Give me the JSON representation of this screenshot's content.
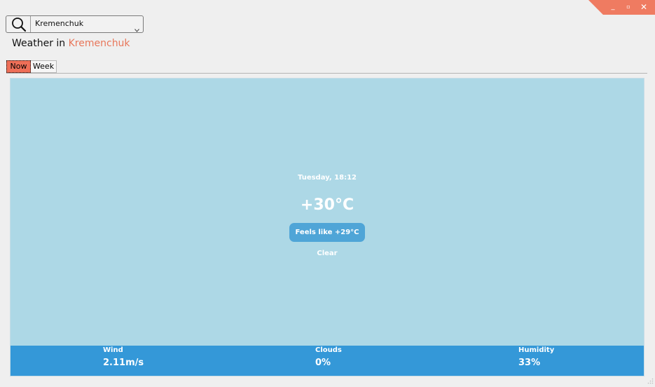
{
  "window": {
    "minimize_glyph": "_",
    "maximize_glyph": "▫",
    "close_glyph": "✕",
    "accent_color": "#ef7b61"
  },
  "search": {
    "icon": "search-icon",
    "selected_city": "Kremenchuk",
    "dropdown_icon": "chevron-down-icon"
  },
  "header": {
    "title_prefix": "Weather in",
    "city": "Kremenchuk",
    "city_color": "#e8775b"
  },
  "tabs": [
    {
      "label": "Now",
      "active": true
    },
    {
      "label": "Week",
      "active": false
    }
  ],
  "current": {
    "datetime": "Tuesday, 18:12",
    "temperature": "+30°C",
    "feels_like": "Feels like +29°C",
    "condition": "Clear",
    "panel_color": "#add8e6",
    "badge_color": "#4fa5d7"
  },
  "stats": {
    "bar_color": "#3498d8",
    "wind": {
      "label": "Wind",
      "value": "2.11m/s"
    },
    "clouds": {
      "label": "Clouds",
      "value": "0%"
    },
    "humidity": {
      "label": "Humidity",
      "value": "33%"
    }
  }
}
